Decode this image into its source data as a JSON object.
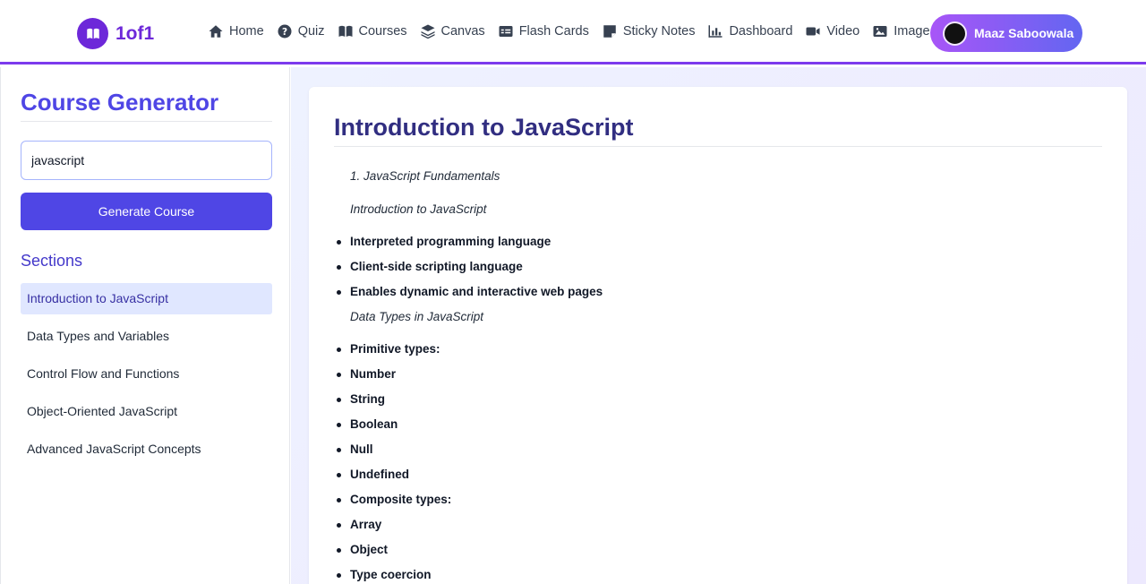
{
  "header": {
    "logo_text": "1of1",
    "nav": [
      {
        "label": "Home",
        "icon": "home-icon"
      },
      {
        "label": "Quiz",
        "icon": "question-icon"
      },
      {
        "label": "Courses",
        "icon": "book-icon"
      },
      {
        "label": "Canvas",
        "icon": "layers-icon"
      },
      {
        "label": "Flash Cards",
        "icon": "card-icon"
      },
      {
        "label": "Sticky Notes",
        "icon": "note-icon"
      },
      {
        "label": "Dashboard",
        "icon": "chart-icon"
      },
      {
        "label": "Video",
        "icon": "video-icon"
      },
      {
        "label": "Image",
        "icon": "image-icon"
      }
    ],
    "user_name": "Maaz Saboowala"
  },
  "sidebar": {
    "title": "Course Generator",
    "search_value": "javascript",
    "generate_label": "Generate Course",
    "sections_title": "Sections",
    "sections": [
      "Introduction to JavaScript",
      "Data Types and Variables",
      "Control Flow and Functions",
      "Object-Oriented JavaScript",
      "Advanced JavaScript Concepts"
    ]
  },
  "main": {
    "title": "Introduction to JavaScript",
    "line1": "1. JavaScript Fundamentals",
    "line2": "Introduction to JavaScript",
    "bullets1": [
      "Interpreted programming language",
      "Client-side scripting language",
      "Enables dynamic and interactive web pages"
    ],
    "line3": "Data Types in JavaScript",
    "bullets2": [
      "Primitive types:",
      "Number",
      "String",
      "Boolean",
      "Null",
      "Undefined",
      "Composite types:",
      "Array",
      "Object",
      "Type coercion"
    ]
  }
}
